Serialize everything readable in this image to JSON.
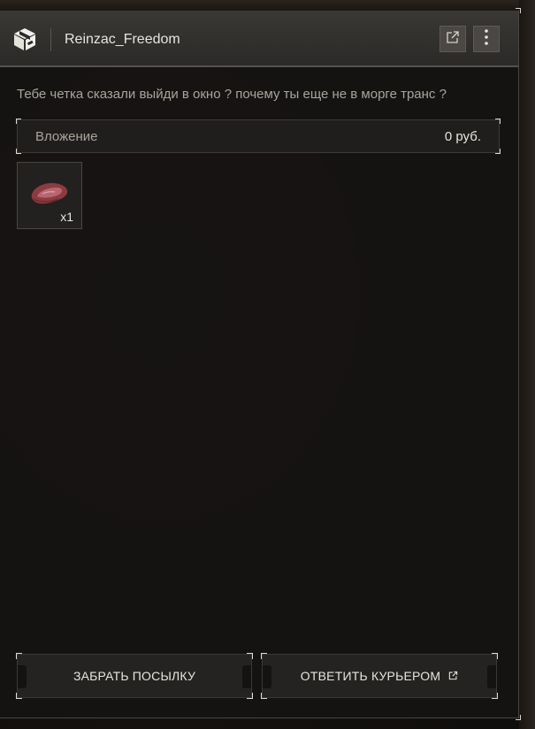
{
  "header": {
    "title": "Reinzac_Freedom",
    "icon": "package-icon",
    "open_icon": "external-link-icon",
    "menu_icon": "more-vertical-icon"
  },
  "message": {
    "text": "Тебе четка сказали выйди в окно ? почему ты еще не в морге транс ?"
  },
  "attachment": {
    "label": "Вложение",
    "value": "0 руб."
  },
  "items": [
    {
      "icon": "raw-meat-icon",
      "quantity": "x1"
    }
  ],
  "actions": {
    "take_label": "ЗАБРАТЬ ПОСЫЛКУ",
    "reply_label": "ОТВЕТИТЬ КУРЬЕРОМ",
    "reply_icon": "external-link-icon"
  }
}
